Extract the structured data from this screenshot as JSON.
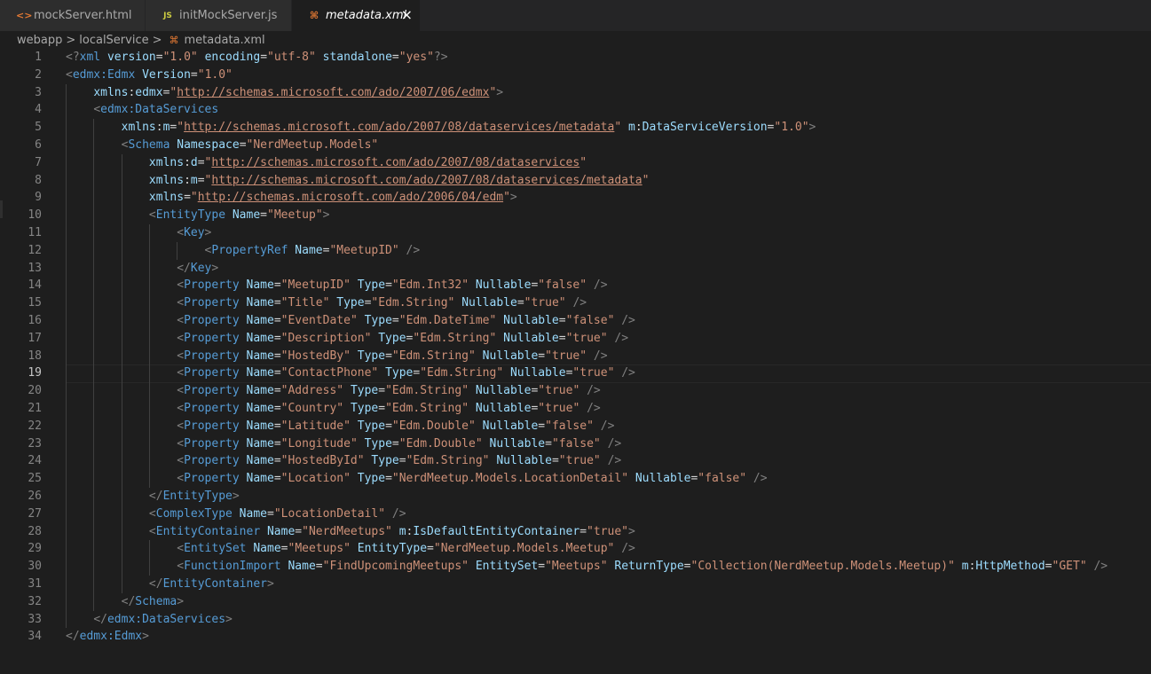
{
  "tabs": [
    {
      "label": "mockServer.html",
      "icon": "html-file-icon"
    },
    {
      "label": "initMockServer.js",
      "icon": "js-file-icon"
    },
    {
      "label": "metadata.xml",
      "icon": "xml-file-icon",
      "active": true
    }
  ],
  "tab_glyphs": {
    "html": "<>",
    "js": "JS",
    "xml": "⌘",
    "close": "×"
  },
  "breadcrumb": {
    "items": [
      "webapp",
      "localService",
      "metadata.xml"
    ],
    "separator": ">",
    "file_icon": "⌘"
  },
  "current_line": 19,
  "line_numbers": [
    "1",
    "2",
    "3",
    "4",
    "5",
    "6",
    "7",
    "8",
    "9",
    "10",
    "11",
    "12",
    "13",
    "14",
    "15",
    "16",
    "17",
    "18",
    "19",
    "20",
    "21",
    "22",
    "23",
    "24",
    "25",
    "26",
    "27",
    "28",
    "29",
    "30",
    "31",
    "32",
    "33",
    "34"
  ],
  "code_lines": [
    "<?xml version=\"1.0\" encoding=\"utf-8\" standalone=\"yes\"?>",
    "<edmx:Edmx Version=\"1.0\"",
    "    xmlns:edmx=\"http://schemas.microsoft.com/ado/2007/06/edmx\">",
    "    <edmx:DataServices",
    "        xmlns:m=\"http://schemas.microsoft.com/ado/2007/08/dataservices/metadata\" m:DataServiceVersion=\"1.0\">",
    "        <Schema Namespace=\"NerdMeetup.Models\"",
    "            xmlns:d=\"http://schemas.microsoft.com/ado/2007/08/dataservices\"",
    "            xmlns:m=\"http://schemas.microsoft.com/ado/2007/08/dataservices/metadata\"",
    "            xmlns=\"http://schemas.microsoft.com/ado/2006/04/edm\">",
    "            <EntityType Name=\"Meetup\">",
    "                <Key>",
    "                    <PropertyRef Name=\"MeetupID\" />",
    "                </Key>",
    "                <Property Name=\"MeetupID\" Type=\"Edm.Int32\" Nullable=\"false\" />",
    "                <Property Name=\"Title\" Type=\"Edm.String\" Nullable=\"true\" />",
    "                <Property Name=\"EventDate\" Type=\"Edm.DateTime\" Nullable=\"false\" />",
    "                <Property Name=\"Description\" Type=\"Edm.String\" Nullable=\"true\" />",
    "                <Property Name=\"HostedBy\" Type=\"Edm.String\" Nullable=\"true\" />",
    "                <Property Name=\"ContactPhone\" Type=\"Edm.String\" Nullable=\"true\" />",
    "                <Property Name=\"Address\" Type=\"Edm.String\" Nullable=\"true\" />",
    "                <Property Name=\"Country\" Type=\"Edm.String\" Nullable=\"true\" />",
    "                <Property Name=\"Latitude\" Type=\"Edm.Double\" Nullable=\"false\" />",
    "                <Property Name=\"Longitude\" Type=\"Edm.Double\" Nullable=\"false\" />",
    "                <Property Name=\"HostedById\" Type=\"Edm.String\" Nullable=\"true\" />",
    "                <Property Name=\"Location\" Type=\"NerdMeetup.Models.LocationDetail\" Nullable=\"false\" />",
    "            </EntityType>",
    "            <ComplexType Name=\"LocationDetail\" />",
    "            <EntityContainer Name=\"NerdMeetups\" m:IsDefaultEntityContainer=\"true\">",
    "                <EntitySet Name=\"Meetups\" EntityType=\"NerdMeetup.Models.Meetup\" />",
    "                <FunctionImport Name=\"FindUpcomingMeetups\" EntitySet=\"Meetups\" ReturnType=\"Collection(NerdMeetup.Models.Meetup)\" m:HttpMethod=\"GET\" />",
    "            </EntityContainer>",
    "        </Schema>",
    "    </edmx:DataServices>",
    "</edmx:Edmx>"
  ],
  "colors": {
    "editor_bg": "#1e1e1e",
    "tab_bar_bg": "#252526",
    "tab_inactive_bg": "#2d2d2d",
    "tag": "#569cd6",
    "attribute": "#9cdcfe",
    "string": "#ce9178",
    "punctuation": "#808080",
    "text": "#d4d4d4",
    "line_number": "#858585",
    "html_icon": "#e37933",
    "js_icon": "#cbcb41",
    "xml_icon": "#e37933"
  }
}
